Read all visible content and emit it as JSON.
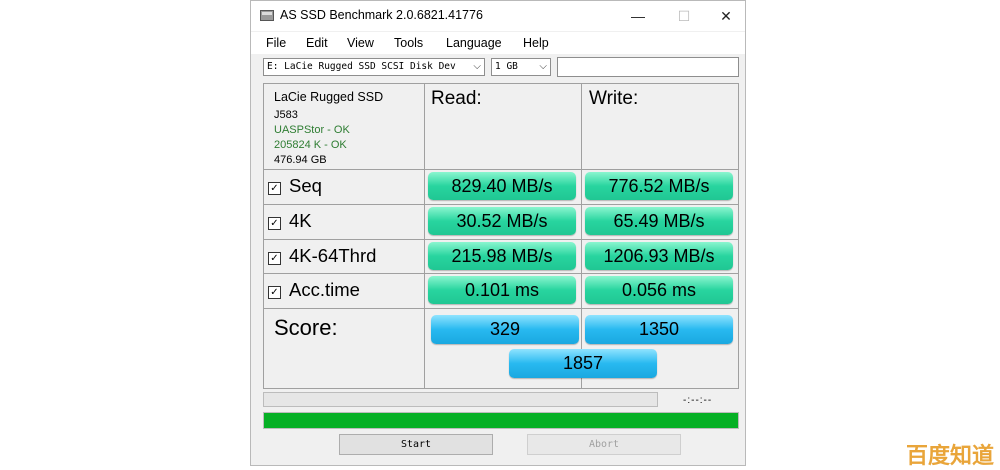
{
  "window": {
    "title": "AS SSD Benchmark 2.0.6821.41776",
    "controls": {
      "minimize": "—",
      "maximize": "☐",
      "close": "✕"
    }
  },
  "menu": [
    "File",
    "Edit",
    "View",
    "Tools",
    "Language",
    "Help"
  ],
  "drive_select": {
    "value": "E: LaCie Rugged SSD SCSI Disk Dev"
  },
  "size_select": {
    "value": "1 GB"
  },
  "device_info": {
    "name": "LaCie Rugged SSD",
    "model": "J583",
    "driver": "UASPStor - OK",
    "alignment": "205824 K - OK",
    "capacity": "476.94 GB"
  },
  "columns": {
    "read": "Read:",
    "write": "Write:"
  },
  "rows": [
    {
      "label": "Seq",
      "checked": true,
      "read": "829.40 MB/s",
      "write": "776.52 MB/s"
    },
    {
      "label": "4K",
      "checked": true,
      "read": "30.52 MB/s",
      "write": "65.49 MB/s"
    },
    {
      "label": "4K-64Thrd",
      "checked": true,
      "read": "215.98 MB/s",
      "write": "1206.93 MB/s"
    },
    {
      "label": "Acc.time",
      "checked": true,
      "read": "0.101 ms",
      "write": "0.056 ms"
    }
  ],
  "score": {
    "label": "Score:",
    "read": "329",
    "write": "1350",
    "total": "1857"
  },
  "status": {
    "timer": "-:--:--",
    "progress_fraction": 1.0,
    "progress_color": "#06b025"
  },
  "buttons": {
    "start": "Start",
    "abort": "Abort"
  },
  "colors": {
    "result_green": "#28d59f",
    "score_blue": "#28b9f0"
  },
  "watermark": "百度知道"
}
